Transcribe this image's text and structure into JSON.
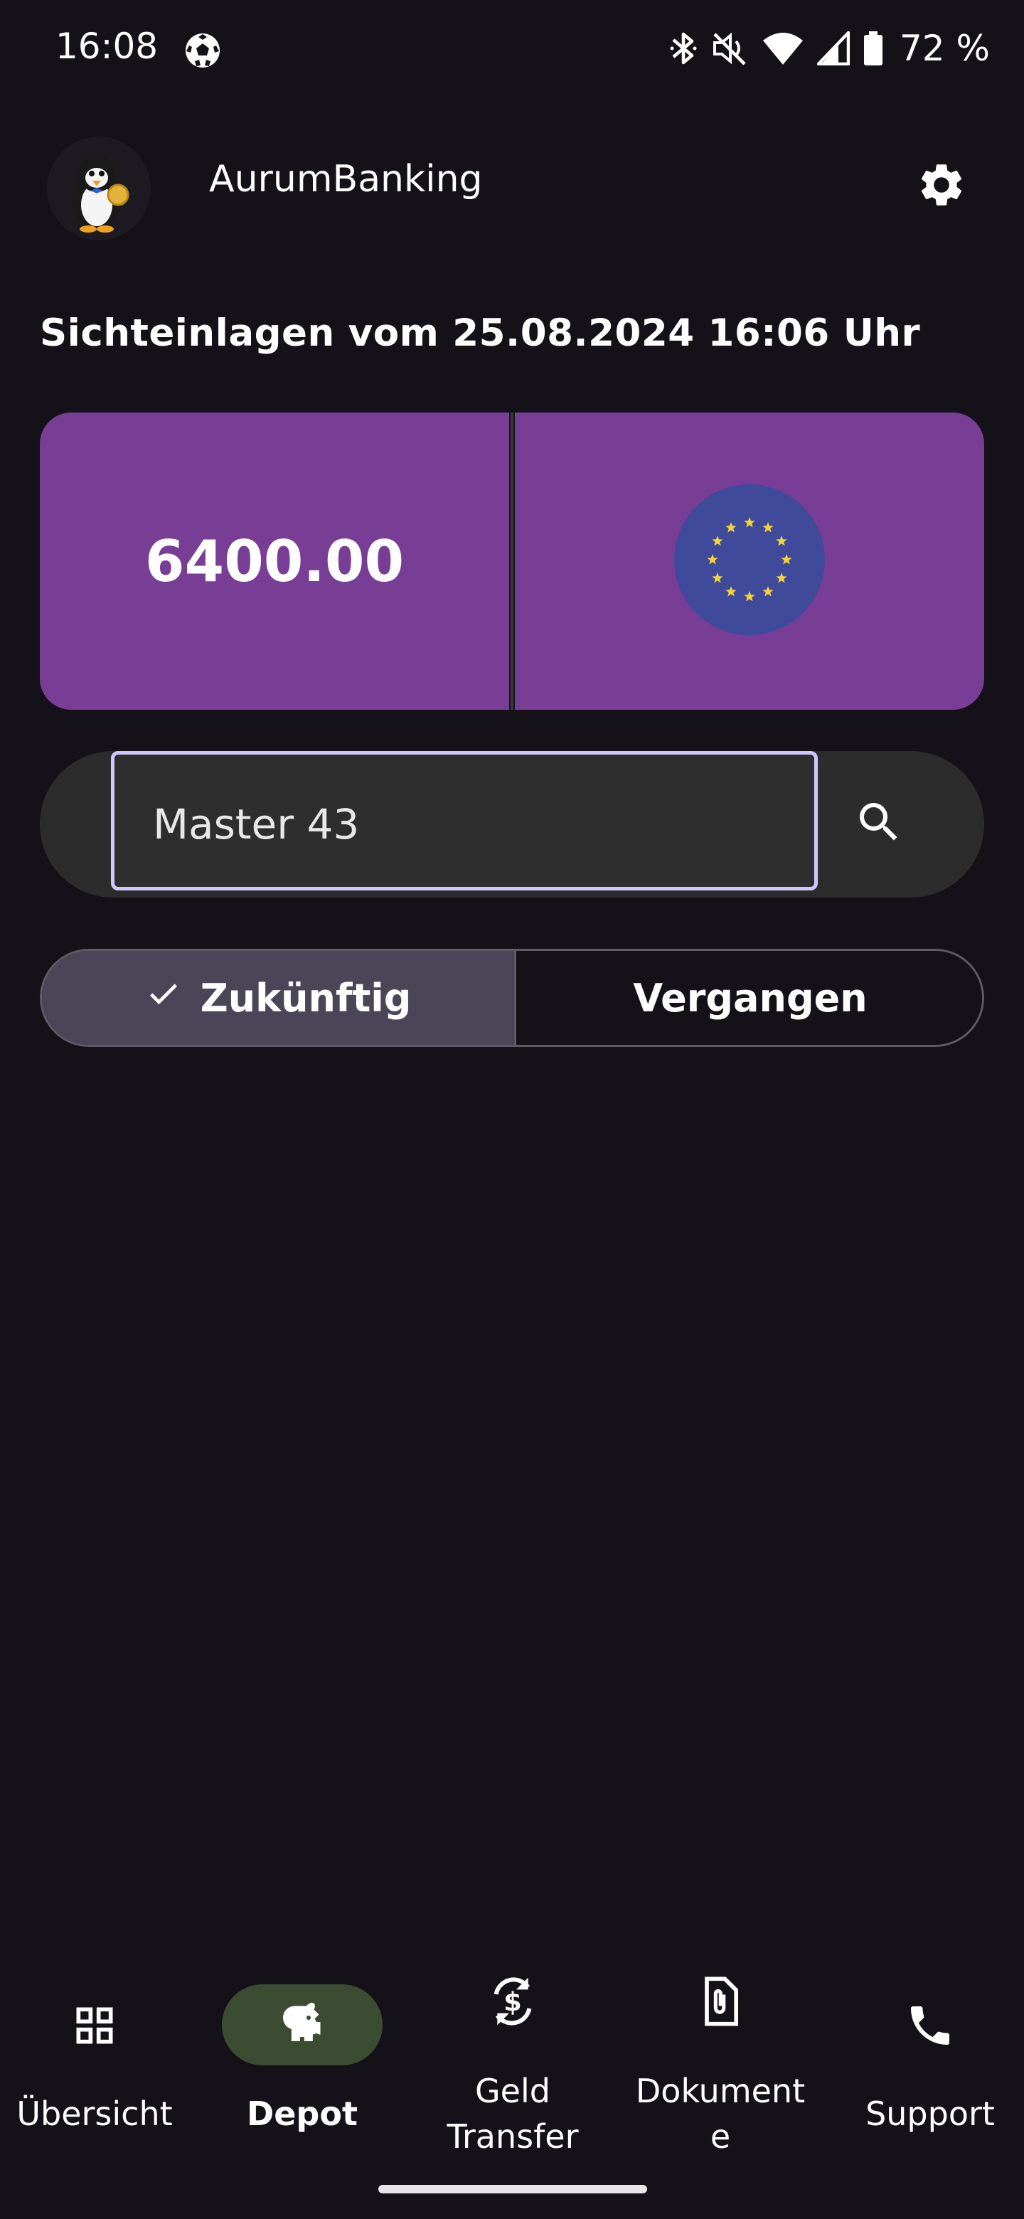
{
  "status_bar": {
    "time": "16:08",
    "battery_text": "72 %",
    "icons": [
      "soccer-ball-icon",
      "bluetooth-icon",
      "mute-icon",
      "wifi-icon",
      "cell-signal-icon",
      "battery-icon"
    ]
  },
  "app_bar": {
    "title": "AurumBanking",
    "avatar_icon": "penguin-avatar",
    "settings_icon": "gear-icon"
  },
  "subtitle": "Sichteinlagen vom 25.08.2024 16:06 Uhr",
  "balance": {
    "amount": "6400.00",
    "currency_icon": "eu-flag-icon",
    "colors": {
      "card": "#783d95",
      "flag": "#3f4a9a",
      "stars": "#f3d23c"
    }
  },
  "search": {
    "value": "Master 43",
    "search_icon": "search-icon"
  },
  "segmented": {
    "selected_label": "Zukünftig",
    "other_label": "Vergangen"
  },
  "bottom_nav": {
    "items": [
      {
        "label": "Übersicht",
        "icon": "grid-icon"
      },
      {
        "label": "Depot",
        "icon": "piggy-bank-icon",
        "active": true
      },
      {
        "label_line1": "Geld",
        "label_line2": "Transfer",
        "icon": "currency-exchange-icon"
      },
      {
        "label_line1": "Dokument",
        "label_line2": "e",
        "icon": "document-attachment-icon"
      },
      {
        "label": "Support",
        "icon": "phone-icon"
      }
    ]
  }
}
